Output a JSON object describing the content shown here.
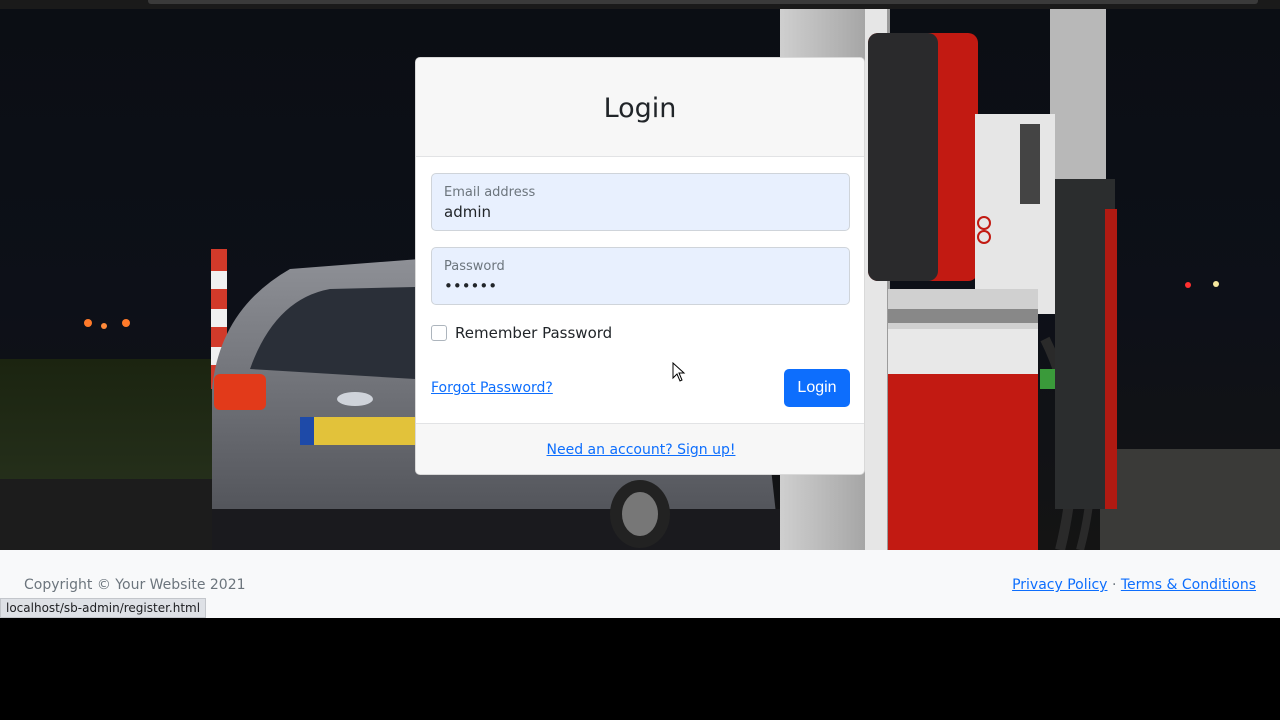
{
  "login": {
    "title": "Login",
    "email": {
      "label": "Email address",
      "value": "admin"
    },
    "password": {
      "label": "Password",
      "value": "••••••"
    },
    "remember_label": "Remember Password",
    "forgot_link": "Forgot Password?",
    "submit_label": "Login",
    "signup_link": "Need an account? Sign up!"
  },
  "footer": {
    "copyright": "Copyright © Your Website 2021",
    "privacy": "Privacy Policy",
    "separator": "·",
    "terms": "Terms & Conditions"
  },
  "status_bar": {
    "url": "localhost/sb-admin/register.html"
  },
  "icons": {
    "cursor": "mouse-pointer-icon"
  },
  "colors": {
    "primary": "#0d6efd",
    "autofill_bg": "#e8f0fe",
    "footer_bg": "#f8f9fa"
  }
}
